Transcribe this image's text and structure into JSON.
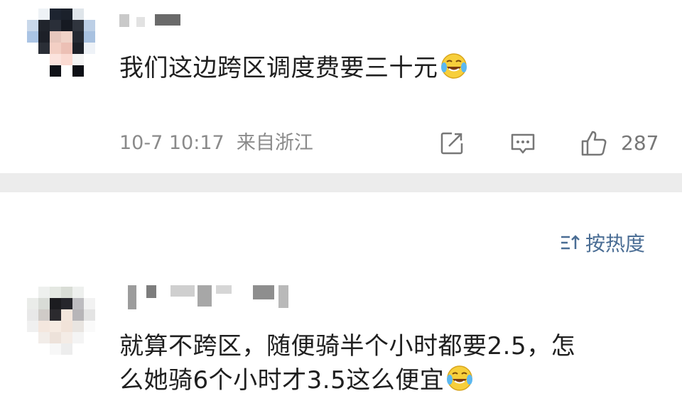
{
  "comments": [
    {
      "text": "我们这边跨区调度费要三十元",
      "emoji": "crying-laughing-emoji",
      "time": "10-7 10:17",
      "location": "来自浙江",
      "like_count": "287"
    },
    {
      "line1": "就算不跨区，随便骑半个小时都要2.5，怎",
      "line2": "么她骑6个小时才3.5这么便宜",
      "emoji": "crying-laughing-emoji"
    }
  ],
  "sort": {
    "label": "按热度",
    "icon": "sort-icon"
  },
  "colors": {
    "link": "#4a6d94",
    "meta": "#8a8a8a",
    "divider": "#ececec"
  }
}
